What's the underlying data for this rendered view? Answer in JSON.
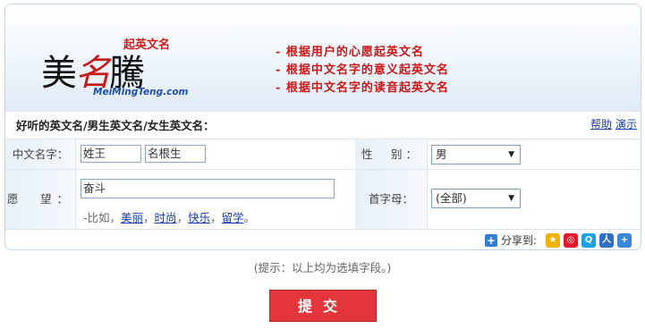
{
  "header": {
    "logo_text_1": "美",
    "logo_text_2": "名",
    "logo_text_3": "騰",
    "logo_tagline": "起英文名",
    "logo_url": "MeiMingTeng.com",
    "slogans": [
      "- 根据用户的心愿起英文名",
      "- 根据中文名字的意义起英文名",
      "- 根据中文名字的读音起英文名"
    ]
  },
  "section": {
    "title": "好听的英文名/男生英文名/女生英文名：",
    "help_link": "帮助",
    "demo_link": "演示"
  },
  "form": {
    "chinese_name_label": "中文名字：",
    "surname_prefix": "姓",
    "surname_value": "王",
    "given_prefix": "名",
    "given_value": "根生",
    "gender_label": "性　别：",
    "gender_value": "男",
    "wish_label": "愿　望：",
    "wish_value": "奋斗",
    "examples_prefix": "-比如，",
    "examples": [
      "美丽",
      "时尚",
      "快乐",
      "留学"
    ],
    "examples_sep": "，",
    "examples_end": "。",
    "initial_label": "首字母：",
    "initial_value": "(全部)"
  },
  "share": {
    "label": "分享到:",
    "icons": [
      "qzone-icon",
      "weibo-icon",
      "qq-icon",
      "renren-icon",
      "more-icon"
    ]
  },
  "hint": "(提示：以上均为选填字段。)",
  "submit_label": "提交",
  "colors": {
    "accent_red": "#e4363a",
    "slogan_red": "#d01515",
    "link_blue": "#1a3fa8"
  }
}
